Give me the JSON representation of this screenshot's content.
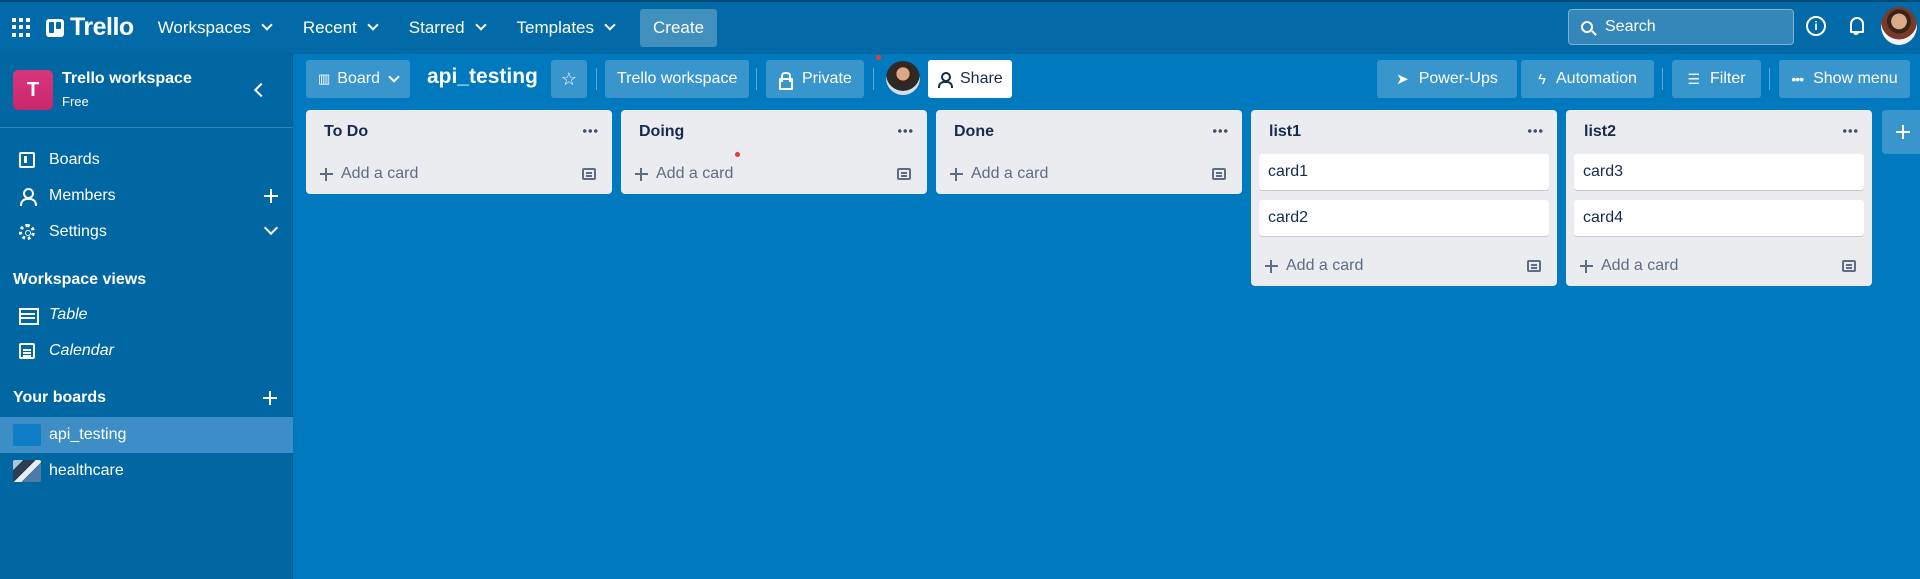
{
  "topbar": {
    "logo_text": "Trello",
    "menus": [
      "Workspaces",
      "Recent",
      "Starred",
      "Templates"
    ],
    "create_label": "Create",
    "search_placeholder": "Search"
  },
  "sidebar": {
    "workspace_initial": "T",
    "workspace_name": "Trello workspace",
    "workspace_plan": "Free",
    "nav": [
      "Boards",
      "Members",
      "Settings"
    ],
    "views_title": "Workspace views",
    "views": [
      "Table",
      "Calendar"
    ],
    "boards_title": "Your boards",
    "boards": [
      "api_testing",
      "healthcare"
    ]
  },
  "boardbar": {
    "view_label": "Board",
    "title": "api_testing",
    "workspace_label": "Trello workspace",
    "visibility_label": "Private",
    "share_label": "Share",
    "powerups_label": "Power-Ups",
    "automation_label": "Automation",
    "filter_label": "Filter",
    "menu_label": "Show menu"
  },
  "lists": [
    {
      "title": "To Do",
      "cards": [],
      "add_label": "Add a card"
    },
    {
      "title": "Doing",
      "cards": [],
      "add_label": "Add a card"
    },
    {
      "title": "Done",
      "cards": [],
      "add_label": "Add a card"
    },
    {
      "title": "list1",
      "cards": [
        "card1",
        "card2"
      ],
      "add_label": "Add a card"
    },
    {
      "title": "list2",
      "cards": [
        "card3",
        "card4"
      ],
      "add_label": "Add a card"
    }
  ],
  "colors": {
    "board_bg": "#0079bf",
    "topbar_bg": "#026aa7",
    "sidebar_bg": "#0067a3",
    "list_bg": "#ebecf0",
    "workspace_avatar": "#d9367e"
  }
}
